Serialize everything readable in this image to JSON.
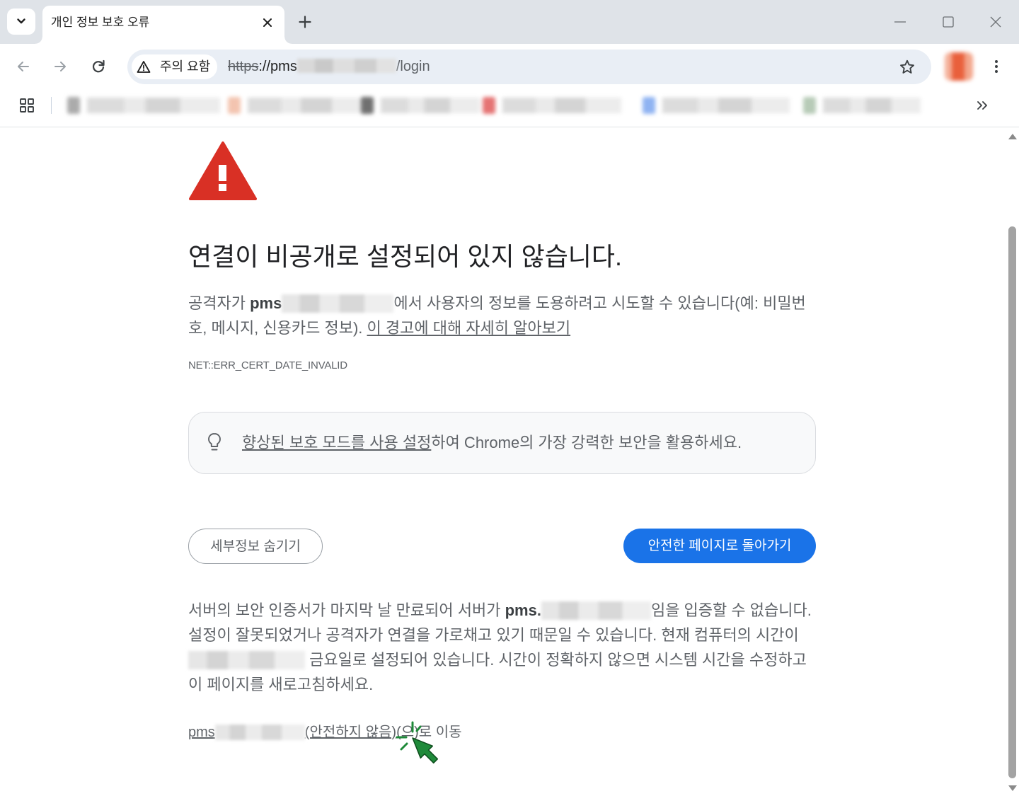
{
  "window": {
    "tab_title": "개인 정보 보호 오류"
  },
  "omnibox": {
    "security_chip": "주의 요함",
    "scheme": "https",
    "host_prefix": "://pms",
    "path": "/login"
  },
  "page": {
    "heading": "연결이 비공개로 설정되어 있지 않습니다.",
    "intro": {
      "prefix": "공격자가 ",
      "host": "pms",
      "suffix": "에서 사용자의 정보를 도용하려고 시도할 수 있습니다(예: 비밀번호, 메시지, 신용카드 정보). ",
      "learn_more": "이 경고에 대해 자세히 알아보기"
    },
    "error_code": "NET::ERR_CERT_DATE_INVALID",
    "enhanced_protection": {
      "link": "향상된 보호 모드를 사용 설정",
      "text": "하여 Chrome의 가장 강력한 보안을 활용하세요."
    },
    "buttons": {
      "hide_details": "세부정보 숨기기",
      "back_to_safety": "안전한 페이지로 돌아가기"
    },
    "details": {
      "part1": "서버의 보안 인증서가 마지막 날 만료되어 서버가 ",
      "host": "pms.",
      "part2": "임을 입증할 수 없습니다. 설정이 잘못되었거나 공격자가 연결을 가로채고 있기 때문일 수 있습니다. 현재 컴퓨터의 시간이 ",
      "part3": " 금요일로 설정되어 있습니다. 시간이 정확하지 않으면 시스템 시간을 수정하고 이 페이지를 새로고침하세요."
    },
    "proceed": {
      "host": "pms",
      "unsafe_label": "(안전하지 않음)",
      "suffix": "(으)로 이동"
    }
  },
  "icons": [
    "chevron-down-icon",
    "close-icon",
    "plus-icon",
    "minimize-icon",
    "maximize-icon",
    "window-close-icon",
    "back-arrow-icon",
    "forward-arrow-icon",
    "reload-icon",
    "warning-icon",
    "star-icon",
    "more-vert-icon",
    "apps-grid-icon",
    "double-chevron-right-icon",
    "warning-triangle-icon",
    "lightbulb-icon",
    "click-cursor-icon",
    "scroll-up-icon",
    "scroll-down-icon"
  ],
  "colors": {
    "warning_red": "#d93025",
    "primary_blue": "#1a73e8",
    "cursor_green": "#1f8a3a",
    "text_gray": "#5f6368"
  }
}
